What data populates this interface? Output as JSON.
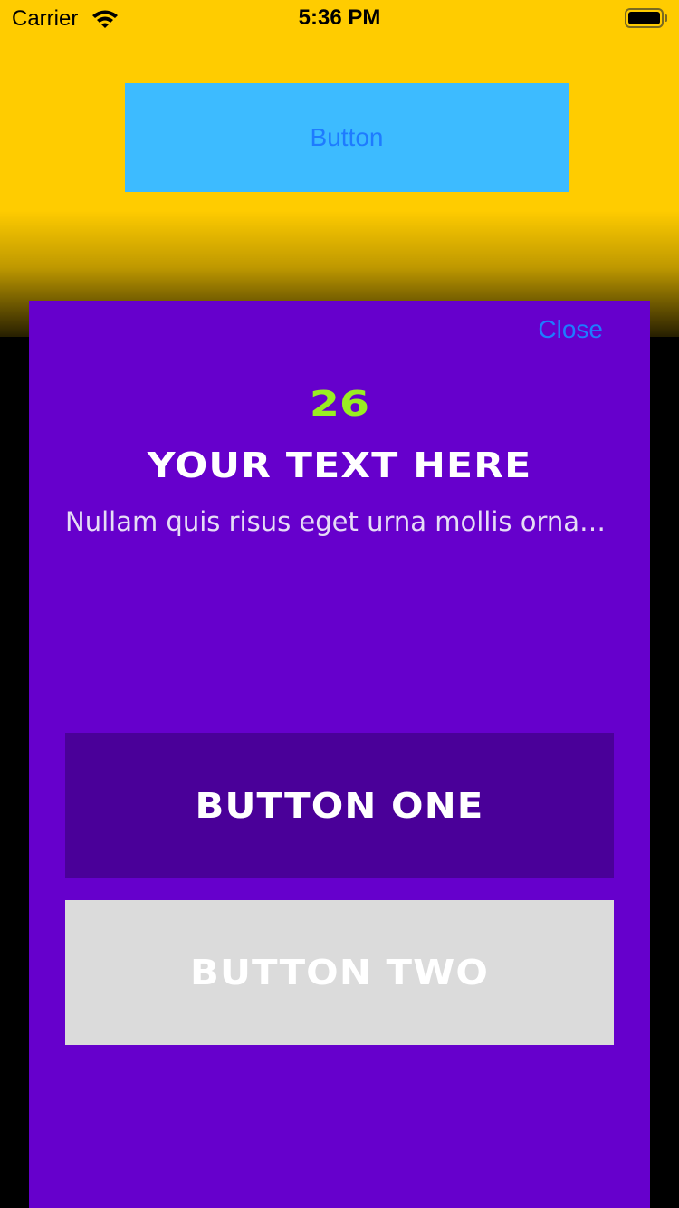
{
  "status_bar": {
    "carrier": "Carrier",
    "time": "5:36 PM",
    "wifi_icon": "wifi-icon",
    "battery_icon": "battery-icon"
  },
  "background": {
    "top_color": "#FFCC00",
    "bottom_color": "#000000",
    "button_label": "Button",
    "button_color": "#3DBBFF",
    "button_text_color": "#1E7BFF"
  },
  "modal": {
    "background_color": "#6600CC",
    "close_label": "Close",
    "count": "26",
    "count_color": "#99EE22",
    "headline": "YOUR TEXT HERE",
    "subtext": "Nullam quis risus eget urna mollis ornare vel eu leo.",
    "button_one": {
      "label": "BUTTON ONE",
      "background": "#4A0099"
    },
    "button_two": {
      "label": "BUTTON TWO",
      "background": "#DBDBDB"
    }
  }
}
